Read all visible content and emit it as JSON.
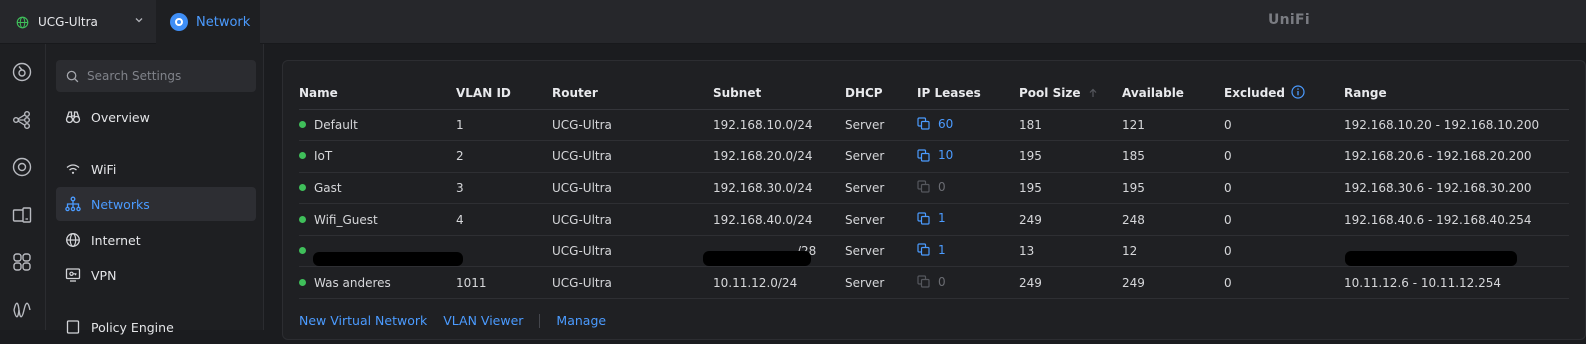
{
  "header": {
    "site_name": "UCG-Ultra",
    "app_name": "Network",
    "logo_text": "UniFi",
    "accent_color": "#4b9bff"
  },
  "search": {
    "placeholder": "Search Settings"
  },
  "sidebar": {
    "items": [
      {
        "label": "Overview",
        "icon": "binoculars-icon",
        "active": false
      },
      {
        "label": "WiFi",
        "icon": "wifi-icon",
        "active": false
      },
      {
        "label": "Networks",
        "icon": "network-tree-icon",
        "active": true
      },
      {
        "label": "Internet",
        "icon": "globe-icon",
        "active": false
      },
      {
        "label": "VPN",
        "icon": "vpn-monitor-icon",
        "active": false
      },
      {
        "label": "Policy Engine",
        "icon": "policy-icon",
        "active": false
      }
    ]
  },
  "iconrail": [
    "dashboard-icon",
    "topology-icon",
    "devices-icon",
    "client-devices-icon",
    "apps-grid-icon",
    "insights-icon"
  ],
  "table": {
    "columns": [
      "Name",
      "VLAN ID",
      "Router",
      "Subnet",
      "DHCP",
      "IP Leases",
      "Pool Size",
      "Available",
      "Excluded",
      "Range"
    ],
    "rows": [
      {
        "name": "Default",
        "vlan": "1",
        "router": "UCG-Ultra",
        "subnet": "192.168.10.0/24",
        "dhcp": "Server",
        "leases": "60",
        "leases_active": true,
        "pool": "181",
        "available": "121",
        "excluded": "0",
        "range": "192.168.10.20 - 192.168.10.200",
        "status_color": "#3fbf5a"
      },
      {
        "name": "IoT",
        "vlan": "2",
        "router": "UCG-Ultra",
        "subnet": "192.168.20.0/24",
        "dhcp": "Server",
        "leases": "10",
        "leases_active": true,
        "pool": "195",
        "available": "185",
        "excluded": "0",
        "range": "192.168.20.6 - 192.168.20.200",
        "status_color": "#3fbf5a"
      },
      {
        "name": "Gast",
        "vlan": "3",
        "router": "UCG-Ultra",
        "subnet": "192.168.30.0/24",
        "dhcp": "Server",
        "leases": "0",
        "leases_active": false,
        "pool": "195",
        "available": "195",
        "excluded": "0",
        "range": "192.168.30.6 - 192.168.30.200",
        "status_color": "#3fbf5a"
      },
      {
        "name": "Wifi_Guest",
        "vlan": "4",
        "router": "UCG-Ultra",
        "subnet": "192.168.40.0/24",
        "dhcp": "Server",
        "leases": "1",
        "leases_active": true,
        "pool": "249",
        "available": "248",
        "excluded": "0",
        "range": "192.168.40.6 - 192.168.40.254",
        "status_color": "#3fbf5a"
      },
      {
        "name": "",
        "vlan": "",
        "router": "UCG-Ultra",
        "subnet": "/28",
        "dhcp": "Server",
        "leases": "1",
        "leases_active": true,
        "pool": "13",
        "available": "12",
        "excluded": "0",
        "range": "",
        "status_color": "#3fbf5a",
        "redacted": true
      },
      {
        "name": "Was anderes",
        "vlan": "1011",
        "router": "UCG-Ultra",
        "subnet": "10.11.12.0/24",
        "dhcp": "Server",
        "leases": "0",
        "leases_active": false,
        "pool": "249",
        "available": "249",
        "excluded": "0",
        "range": "10.11.12.6 - 10.11.12.254",
        "status_color": "#3fbf5a"
      }
    ]
  },
  "footer": {
    "new_virtual_network": "New Virtual Network",
    "vlan_viewer": "VLAN Viewer",
    "manage": "Manage"
  }
}
